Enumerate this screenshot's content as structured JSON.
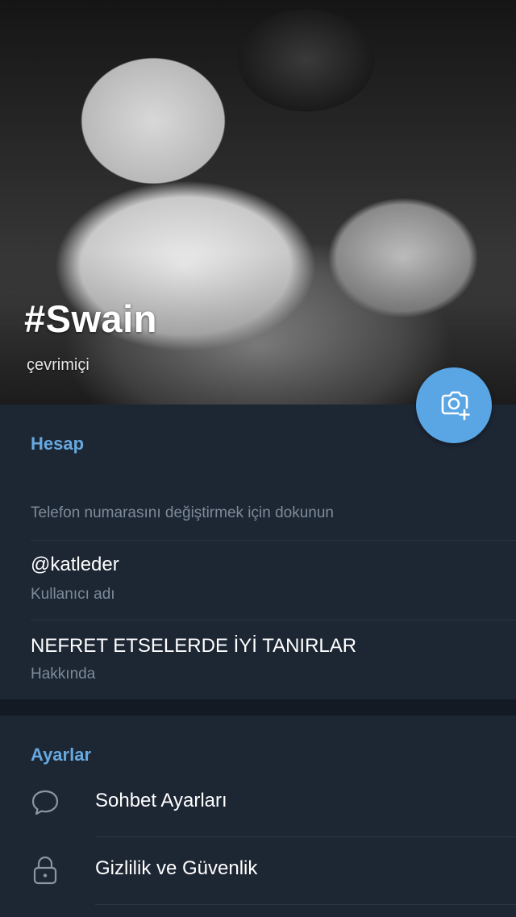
{
  "profile": {
    "name": "#Swain",
    "status": "çevrimiçi"
  },
  "camera_button": {
    "icon": "camera-add-icon"
  },
  "account": {
    "title": "Hesap",
    "phone_hint": "Telefon numarasını değiştirmek için dokunun",
    "username_value": "@katleder",
    "username_label": "Kullanıcı adı",
    "bio_value": "NEFRET ETSELERDE İYİ TANIRLAR",
    "bio_label": "Hakkında"
  },
  "settings": {
    "title": "Ayarlar",
    "items": [
      {
        "label": "Sohbet Ayarları",
        "icon": "chat-bubble-icon"
      },
      {
        "label": "Gizlilik ve Güvenlik",
        "icon": "lock-icon"
      }
    ]
  },
  "colors": {
    "background": "#1d2633",
    "accent": "#66a9e0",
    "fab": "#5aa5e4",
    "secondary_text": "#7d8b99"
  }
}
